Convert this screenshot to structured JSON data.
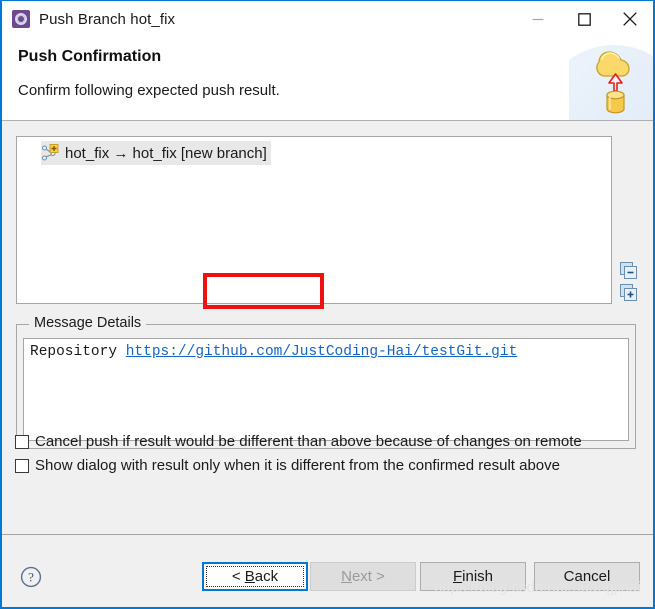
{
  "window": {
    "title": "Push Branch hot_fix",
    "icon": "eclipse-git-icon",
    "controls": {
      "minimize": "minimize-icon",
      "maximize": "maximize-icon",
      "close": "close-icon"
    }
  },
  "header": {
    "title": "Push Confirmation",
    "description": "Confirm following expected push result.",
    "banner_icon": "cloud-push-icon"
  },
  "tree": {
    "items": [
      {
        "icon": "branch-add-icon",
        "label": "hot_fix → hot_fix [new branch]",
        "source": "hot_fix",
        "destination": "hot_fix",
        "status": "[new branch]",
        "highlighted": true
      }
    ],
    "highlight_color": "#ee1111",
    "tools": [
      {
        "name": "collapse-all-icon",
        "glyph": "−"
      },
      {
        "name": "expand-all-icon",
        "glyph": "+"
      }
    ]
  },
  "message_details": {
    "group_title": "Message Details",
    "label": "Repository",
    "url": "https://github.com/JustCoding-Hai/testGit.git",
    "link_color": "#1565c8"
  },
  "options": [
    {
      "label": "Cancel push if result would be different than above because of changes on remote",
      "checked": false
    },
    {
      "label": "Show dialog with result only when it is different from the confirmed result above",
      "checked": false
    }
  ],
  "footer": {
    "help_icon": "help-question-icon",
    "buttons": [
      {
        "name": "back-button",
        "label": "< Back",
        "state": "focused",
        "mnemonic": "B"
      },
      {
        "name": "next-button",
        "label": "Next >",
        "state": "disabled",
        "mnemonic": "N"
      },
      {
        "name": "finish-button",
        "label": "Finish",
        "state": "normal",
        "mnemonic": "F"
      },
      {
        "name": "cancel-button",
        "label": "Cancel",
        "state": "normal",
        "mnemonic": ""
      }
    ],
    "watermark": "https://blog.csdn.net/huangjihai"
  },
  "accent_color": "#0078d7"
}
